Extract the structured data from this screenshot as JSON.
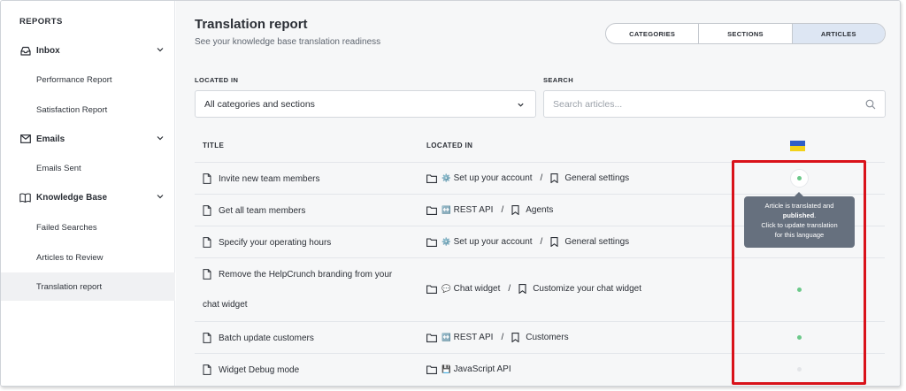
{
  "sidebar": {
    "heading": "REPORTS",
    "groups": [
      {
        "label": "Inbox",
        "icon": "inbox-icon",
        "items": [
          "Performance Report",
          "Satisfaction Report"
        ]
      },
      {
        "label": "Emails",
        "icon": "email-icon",
        "items": [
          "Emails Sent"
        ]
      },
      {
        "label": "Knowledge Base",
        "icon": "book-icon",
        "items": [
          "Failed Searches",
          "Articles to Review",
          "Translation report"
        ]
      }
    ],
    "active_item": "Translation report"
  },
  "page": {
    "title": "Translation report",
    "subtitle": "See your knowledge base translation readiness"
  },
  "tabs": [
    {
      "label": "CATEGORIES",
      "active": false
    },
    {
      "label": "SECTIONS",
      "active": false
    },
    {
      "label": "ARTICLES",
      "active": true
    }
  ],
  "filters": {
    "located_in_label": "LOCATED IN",
    "located_in_value": "All categories and sections",
    "search_label": "SEARCH",
    "search_placeholder": "Search articles..."
  },
  "table": {
    "columns": [
      "TITLE",
      "LOCATED IN"
    ],
    "language_flag": {
      "name": "ukraine-flag",
      "colors": [
        "#2f5fc8",
        "#f2d21a"
      ]
    },
    "rows": [
      {
        "title": "Invite new team members",
        "category_emoji": "⚙️",
        "category": "Set up your account",
        "section": "General settings",
        "status": "published"
      },
      {
        "title": "Get all team members",
        "category_emoji": "↔️",
        "category": "REST API",
        "section": "Agents",
        "status": "published"
      },
      {
        "title": "Specify your operating hours",
        "category_emoji": "⚙️",
        "category": "Set up your account",
        "section": "General settings",
        "status": "published"
      },
      {
        "title_line1": "Remove the HelpCrunch branding from your",
        "title_line2": "chat widget",
        "category_emoji": "💬",
        "category": "Chat widget",
        "section": "Customize your chat widget",
        "status": "published"
      },
      {
        "title": "Batch update customers",
        "category_emoji": "↔️",
        "category": "REST API",
        "section": "Customers",
        "status": "published"
      },
      {
        "title": "Widget Debug mode",
        "category_emoji": "💾",
        "category": "JavaScript API",
        "section": "",
        "status": "not-translated"
      }
    ],
    "separator": "/"
  },
  "tooltip": {
    "line1": "Article is translated and",
    "bold": "published",
    "line2_suffix": ".",
    "line3": "Click to update translation",
    "line4": "for this language"
  },
  "colors": {
    "published_dot": "#6cc98a",
    "not_translated_dot": "#e3e5e8",
    "highlight_box": "#d9121a",
    "active_tab": "#dde6f3"
  }
}
